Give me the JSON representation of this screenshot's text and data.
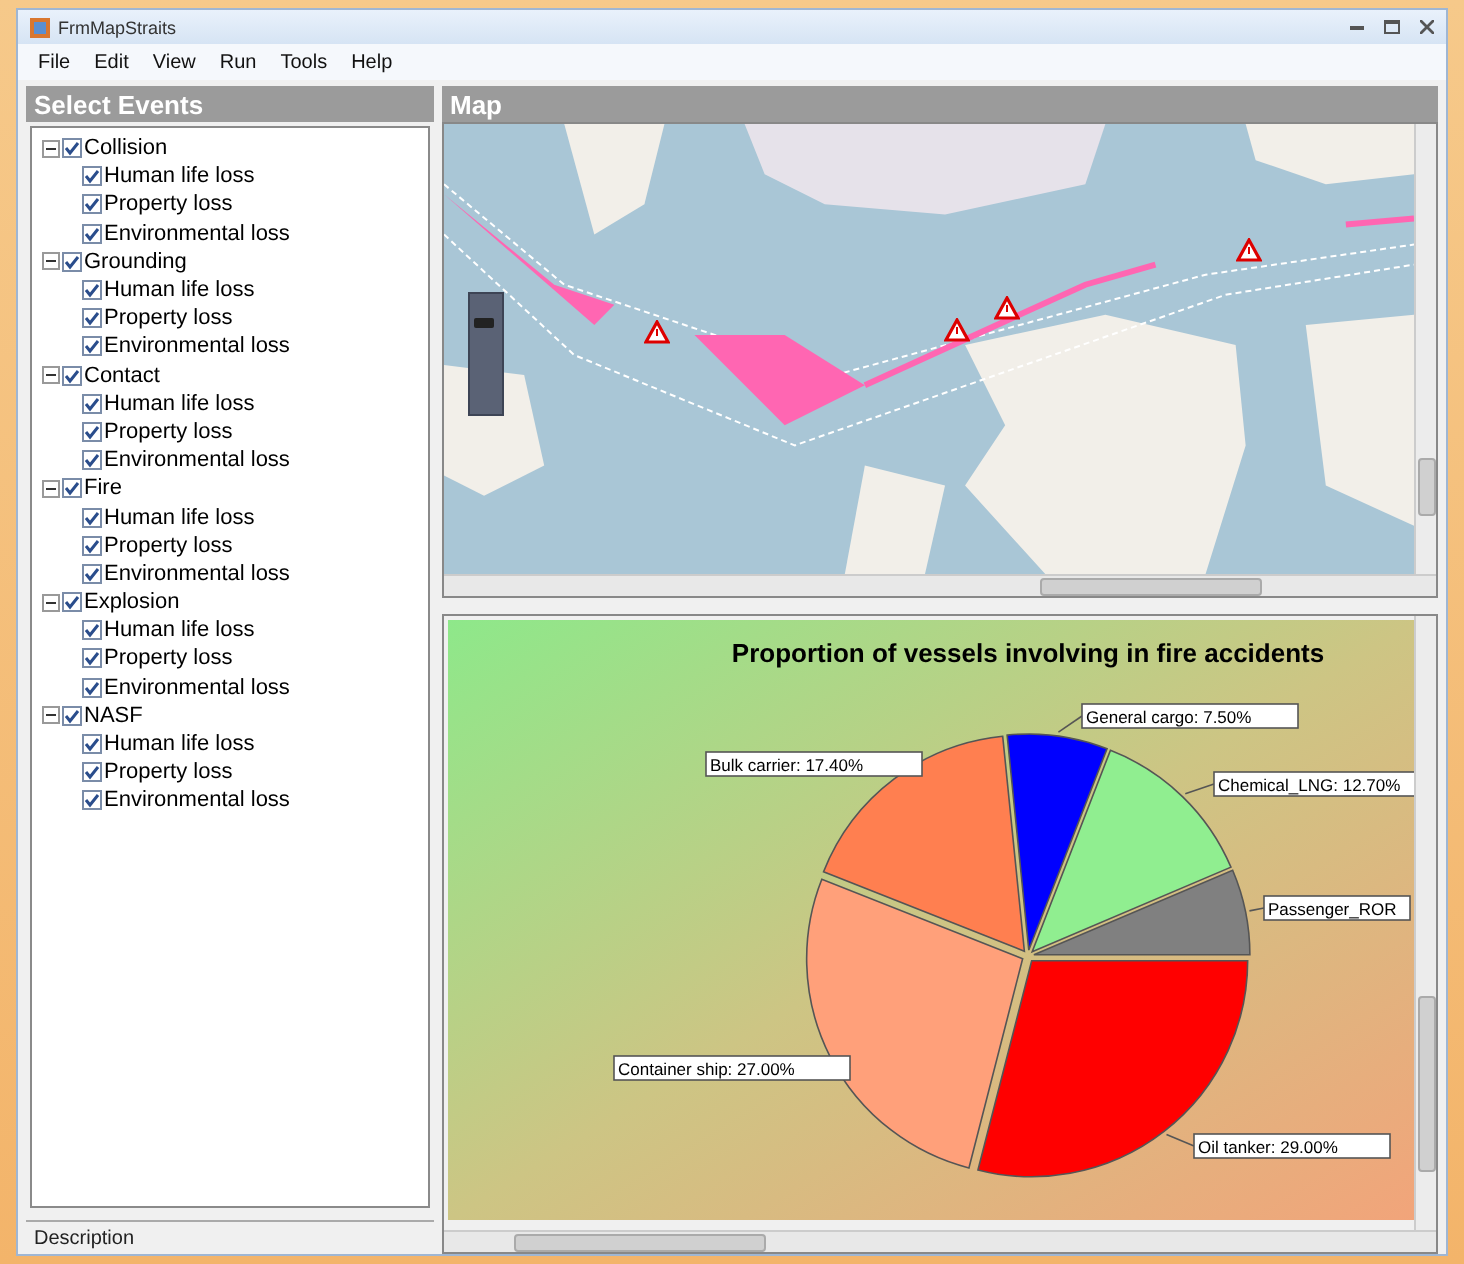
{
  "window": {
    "title": "FrmMapStraits"
  },
  "menu": [
    "File",
    "Edit",
    "View",
    "Run",
    "Tools",
    "Help"
  ],
  "events_panel": {
    "title": "Select Events",
    "tree": [
      {
        "label": "Collision",
        "checked": true,
        "expanded": true,
        "children": [
          {
            "label": "Human life loss",
            "checked": true
          },
          {
            "label": "Property loss",
            "checked": true
          },
          {
            "label": "Environmental loss",
            "checked": true
          }
        ]
      },
      {
        "label": "Grounding",
        "checked": true,
        "expanded": true,
        "children": [
          {
            "label": "Human life loss",
            "checked": true
          },
          {
            "label": "Property loss",
            "checked": true
          },
          {
            "label": "Environmental loss",
            "checked": true
          }
        ]
      },
      {
        "label": "Contact",
        "checked": true,
        "expanded": true,
        "children": [
          {
            "label": "Human life loss",
            "checked": true
          },
          {
            "label": "Property loss",
            "checked": true
          },
          {
            "label": "Environmental loss",
            "checked": true
          }
        ]
      },
      {
        "label": "Fire",
        "checked": true,
        "expanded": true,
        "children": [
          {
            "label": "Human life loss",
            "checked": true
          },
          {
            "label": "Property loss",
            "checked": true
          },
          {
            "label": "Environmental loss",
            "checked": true
          }
        ]
      },
      {
        "label": "Explosion",
        "checked": true,
        "expanded": true,
        "children": [
          {
            "label": "Human life loss",
            "checked": true
          },
          {
            "label": "Property loss",
            "checked": true
          },
          {
            "label": "Environmental loss",
            "checked": true
          }
        ]
      },
      {
        "label": "NASF",
        "checked": true,
        "expanded": true,
        "children": [
          {
            "label": "Human life loss",
            "checked": true
          },
          {
            "label": "Property loss",
            "checked": true
          },
          {
            "label": "Environmental loss",
            "checked": true
          }
        ]
      }
    ],
    "description": {
      "label": "Description"
    }
  },
  "map_panel": {
    "title": "Map",
    "zoom": {
      "level": 0.78
    }
  },
  "chart_panel": {
    "chart_data": {
      "type": "pie",
      "title": "Proportion of vessels involving in fire accidents",
      "categories": [
        "Passenger_ROR",
        "Chemical_LNG: 12.70%",
        "General cargo: 7.50%",
        "Bulk carrier: 17.40%",
        "Container ship: 27.00%",
        "Oil tanker: 29.00%"
      ],
      "series": [
        {
          "values": [
            6.4,
            12.7,
            7.5,
            17.4,
            27.0,
            29.0
          ]
        }
      ]
    }
  }
}
